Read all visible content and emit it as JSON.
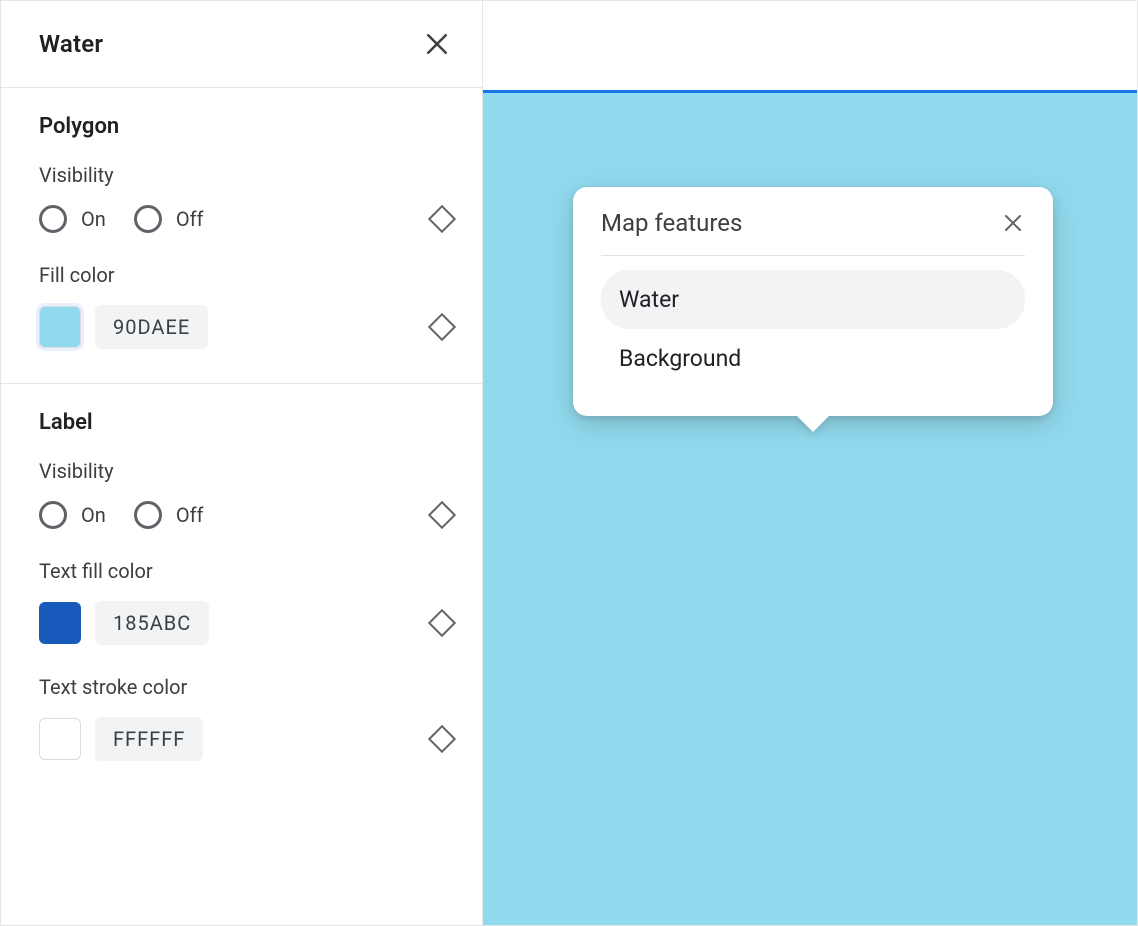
{
  "sidebar": {
    "title": "Water",
    "sections": [
      {
        "title": "Polygon",
        "visibility": {
          "label": "Visibility",
          "on": "On",
          "off": "Off"
        },
        "fill": {
          "label": "Fill color",
          "hex": "90DAEE",
          "css": "#90DAEE"
        }
      },
      {
        "title": "Label",
        "visibility": {
          "label": "Visibility",
          "on": "On",
          "off": "Off"
        },
        "text_fill": {
          "label": "Text fill color",
          "hex": "185ABC",
          "css": "#185ABC"
        },
        "text_stroke": {
          "label": "Text stroke color",
          "hex": "FFFFFF",
          "css": "#FFFFFF"
        }
      }
    ]
  },
  "preview": {
    "water_color": "#90DAEE",
    "accent_color": "#1a73e8",
    "popover": {
      "title": "Map features",
      "items": [
        {
          "label": "Water",
          "selected": true
        },
        {
          "label": "Background",
          "selected": false
        }
      ]
    }
  }
}
